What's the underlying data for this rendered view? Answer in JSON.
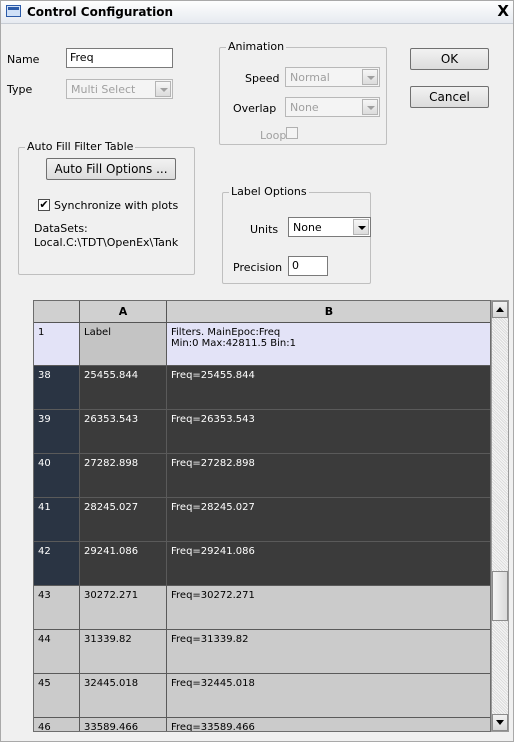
{
  "window": {
    "title": "Control Configuration",
    "close_glyph": "X"
  },
  "name_field": {
    "label": "Name",
    "value": "Freq"
  },
  "type_field": {
    "label": "Type",
    "value": "Multi Select"
  },
  "animation": {
    "title": "Animation",
    "speed_label": "Speed",
    "speed_value": "Normal",
    "overlap_label": "Overlap",
    "overlap_value": "None",
    "loop_label": "Loop"
  },
  "buttons": {
    "ok": "OK",
    "cancel": "Cancel",
    "auto_fill_options": "Auto Fill Options ..."
  },
  "auto_fill": {
    "title": "Auto Fill Filter Table",
    "sync_label": "Synchronize with  plots",
    "sync_checked": true,
    "datasets_label": "DataSets:",
    "datasets_value": "Local.C:\\TDT\\OpenEx\\Tank"
  },
  "label_options": {
    "title": "Label Options",
    "units_label": "Units",
    "units_value": "None",
    "precision_label": "Precision",
    "precision_value": "0"
  },
  "table": {
    "columns": [
      "",
      "A",
      "B"
    ],
    "rows": [
      {
        "num": "1",
        "a": "Label",
        "b": "Filters. MainEpoc:Freq",
        "b2": "Min:0   Max:42811.5   Bin:1",
        "style": "label"
      },
      {
        "num": "38",
        "a": "25455.844",
        "b": "Freq=25455.844",
        "b2": "",
        "style": "dark"
      },
      {
        "num": "39",
        "a": "26353.543",
        "b": "Freq=26353.543",
        "b2": "",
        "style": "dark"
      },
      {
        "num": "40",
        "a": "27282.898",
        "b": "Freq=27282.898",
        "b2": "",
        "style": "dark"
      },
      {
        "num": "41",
        "a": "28245.027",
        "b": "Freq=28245.027",
        "b2": "",
        "style": "dark"
      },
      {
        "num": "42",
        "a": "29241.086",
        "b": "Freq=29241.086",
        "b2": "",
        "style": "dark"
      },
      {
        "num": "43",
        "a": "30272.271",
        "b": "Freq=30272.271",
        "b2": "",
        "style": "light"
      },
      {
        "num": "44",
        "a": "31339.82",
        "b": "Freq=31339.82",
        "b2": "",
        "style": "light"
      },
      {
        "num": "45",
        "a": "32445.018",
        "b": "Freq=32445.018",
        "b2": "",
        "style": "light"
      },
      {
        "num": "46",
        "a": "33589.466",
        "b": "Freq=33589.466",
        "b2": "",
        "style": "light"
      }
    ]
  },
  "colors": {
    "row_dark_bg": "#3b3b3b",
    "row_dark_num_bg": "#2a3443",
    "row_light_bg": "#cbcbcb",
    "row_label_bg": "#e3e3f7",
    "row_label_a_bg": "#c4c4c4"
  },
  "icons": [
    "window-icon",
    "close-icon",
    "dropdown-arrow-icon",
    "scroll-up-icon",
    "scroll-down-icon"
  ]
}
